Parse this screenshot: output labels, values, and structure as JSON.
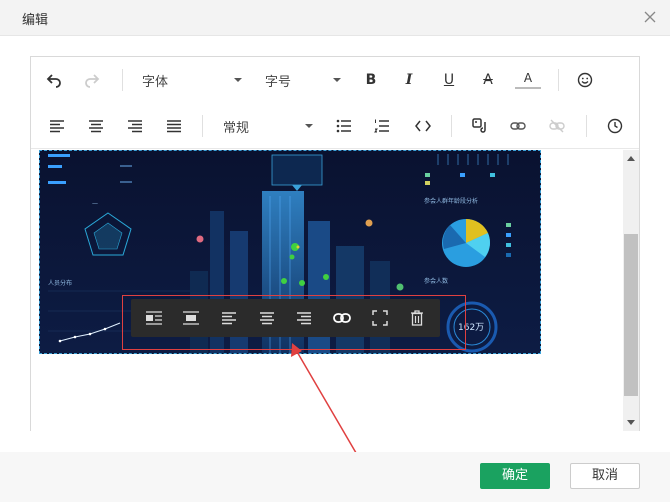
{
  "dialog": {
    "title": "编辑"
  },
  "toolbar": {
    "font_family": "字体",
    "font_size": "字号",
    "paragraph": "常规",
    "bold": "B",
    "italic": "I",
    "underline": "U",
    "strikethrough": "A",
    "font_color": "A"
  },
  "dashboard_image": {
    "labels": {
      "people_dist": "人员分布",
      "group_analysis": "参会人群年龄段分析",
      "attendees": "参会人数",
      "total": "162万"
    }
  },
  "image_toolbar": {
    "icons": [
      "float-left-icon",
      "float-none-icon",
      "align-left-icon",
      "align-center-icon",
      "align-right-icon",
      "link-icon",
      "fullscreen-icon",
      "delete-icon"
    ]
  },
  "footer": {
    "ok": "确定",
    "cancel": "取消"
  },
  "colors": {
    "primary": "#1aa260",
    "annotation": "#e04040",
    "image_bg": "#0b1533"
  }
}
